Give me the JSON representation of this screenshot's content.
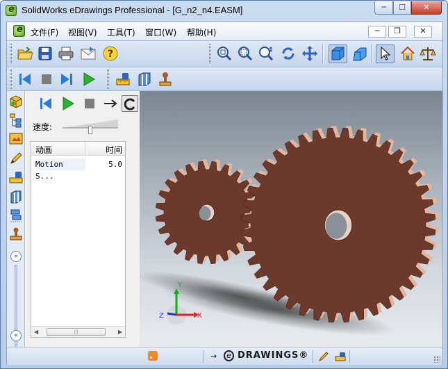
{
  "window": {
    "title": "SolidWorks eDrawings Professional - [G_n2_n4.EASM]",
    "controls": {
      "minimize": "─",
      "maximize": "☐",
      "close": "✕"
    }
  },
  "menubar": {
    "items": [
      "文件(F)",
      "视图(V)",
      "工具(T)",
      "窗口(W)",
      "帮助(H)"
    ],
    "mdi": {
      "minimize": "─",
      "restore": "❐",
      "close": "✕"
    }
  },
  "toolbar1": {
    "left_icons": [
      "open-folder-icon",
      "save-icon",
      "print-icon",
      "email-icon",
      "help-icon"
    ],
    "right_icons": [
      "zoom-to-fit-icon",
      "zoom-to-area-icon",
      "zoom-in-out-icon",
      "rotate-icon",
      "pan-icon",
      "shaded-icon",
      "perspective-icon",
      "select-icon",
      "home-icon",
      "measure-scale-icon"
    ]
  },
  "toolbar2": {
    "icons": [
      "first-frame-icon",
      "stop-icon",
      "next-step-icon",
      "play-icon",
      "measure-icon",
      "section-icon",
      "stamp-icon"
    ]
  },
  "side_tabs": [
    "components-tab-icon",
    "tree-tab-icon",
    "configurations-tab-icon",
    "markup-tab-icon",
    "measure-tab-icon",
    "section-tab-icon",
    "explode-tab-icon",
    "stamp-tab-icon"
  ],
  "animation_panel": {
    "speed_label": "速度:",
    "speed_level": 0.5,
    "columns": {
      "animation": "动画",
      "time": "时间"
    },
    "rows": [
      {
        "name": "Motion S...",
        "time": "5.0"
      }
    ]
  },
  "statusbar": {
    "logo_text": "DRAWINGS®"
  },
  "colors": {
    "gear": "#6b3a2c",
    "gear_edge": "#e3b79f",
    "axis_x": "#e32222",
    "axis_y": "#11aa22",
    "axis_z": "#2233dd"
  },
  "triad": {
    "x": "X",
    "y": "Y",
    "z": "Z"
  }
}
